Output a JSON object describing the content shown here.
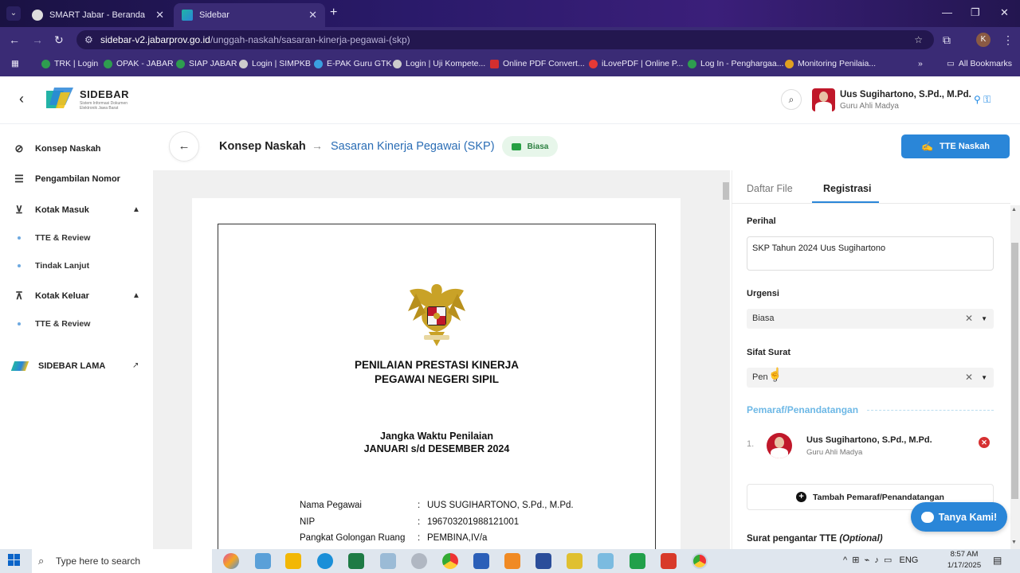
{
  "browser": {
    "tabs": [
      {
        "title": "SMART Jabar - Beranda",
        "close": "✕"
      },
      {
        "title": "Sidebar",
        "close": "✕"
      }
    ],
    "new_tab": "+",
    "url_host": "sidebar-v2.jabarprov.go.id",
    "url_path": "/unggah-naskah/sasaran-kinerja-pegawai-(skp)",
    "bookmarks": [
      "TRK | Login",
      "OPAK - JABAR",
      "SIAP JABAR",
      "Login | SIMPKB",
      "E-PAK Guru GTK",
      "Login | Uji Kompete...",
      "Online PDF Convert...",
      "iLovePDF | Online P...",
      "Log In - Penghargaa...",
      "Monitoring Penilaia..."
    ],
    "all_bookmarks": "All Bookmarks",
    "more": "»"
  },
  "app": {
    "logo_text": "SIDEBAR",
    "logo_sub": "Sistem Informasi Dokumen Elektronik Jawa Barat",
    "user_name": "Uus Sugihartono, S.Pd., M.Pd.",
    "user_role": "Guru Ahli Madya"
  },
  "sidebar": {
    "items": [
      {
        "label": "Konsep Naskah"
      },
      {
        "label": "Pengambilan Nomor"
      },
      {
        "label": "Kotak Masuk"
      },
      {
        "label": "TTE & Review"
      },
      {
        "label": "Tindak Lanjut"
      },
      {
        "label": "Kotak Keluar"
      },
      {
        "label": "TTE & Review"
      },
      {
        "label": "SIDEBAR LAMA"
      }
    ]
  },
  "header": {
    "breadcrumb_1": "Konsep Naskah",
    "breadcrumb_arrow": "→",
    "breadcrumb_2": "Sasaran Kinerja Pegawai (SKP)",
    "badge": "Biasa",
    "tte_button": "TTE Naskah"
  },
  "document": {
    "title_1": "PENILAIAN PRESTASI KINERJA",
    "title_2": "PEGAWAI NEGERI SIPIL",
    "period_label": "Jangka Waktu Penilaian",
    "period_value": "JANUARI s/d DESEMBER 2024",
    "rows": [
      {
        "label": "Nama Pegawai",
        "colon": ":",
        "value": "UUS SUGIHARTONO, S.Pd., M.Pd."
      },
      {
        "label": "NIP",
        "colon": ":",
        "value": "196703201988121001"
      },
      {
        "label": "Pangkat Golongan Ruang",
        "colon": ":",
        "value": "PEMBINA,IV/a"
      }
    ]
  },
  "panel": {
    "tab_files": "Daftar File",
    "tab_registration": "Registrasi",
    "perihal_label": "Perihal",
    "perihal_value": "SKP Tahun 2024 Uus Sugihartono",
    "urgensi_label": "Urgensi",
    "urgensi_value": "Biasa",
    "sifat_label": "Sifat Surat",
    "sifat_value": "Pen  g",
    "clear": "✕",
    "dropdown": "▼",
    "pemaraf_title": "Pemaraf/Penandatangan",
    "pemaraf_num": "1.",
    "pemaraf_name": "Uus Sugihartono, S.Pd., M.Pd.",
    "pemaraf_role": "Guru Ahli Madya",
    "remove": "✕",
    "add_pemaraf": "Tambah Pemaraf/Penandatangan",
    "pengantar_label": "Surat pengantar TTE",
    "pengantar_optional": "(Optional)",
    "chat_button": "Tanya Kami!"
  },
  "taskbar": {
    "search_placeholder": "Type here to search",
    "lang": "ENG",
    "time": "8:57 AM",
    "date": "1/17/2025"
  },
  "colors": {
    "primary": "#2a86d8",
    "accent_link": "#2a6db5",
    "badge_bg": "#e7f6ea",
    "badge_fg": "#26a043",
    "remove_red": "#d63031",
    "browser_chrome": "#3a2b75"
  }
}
